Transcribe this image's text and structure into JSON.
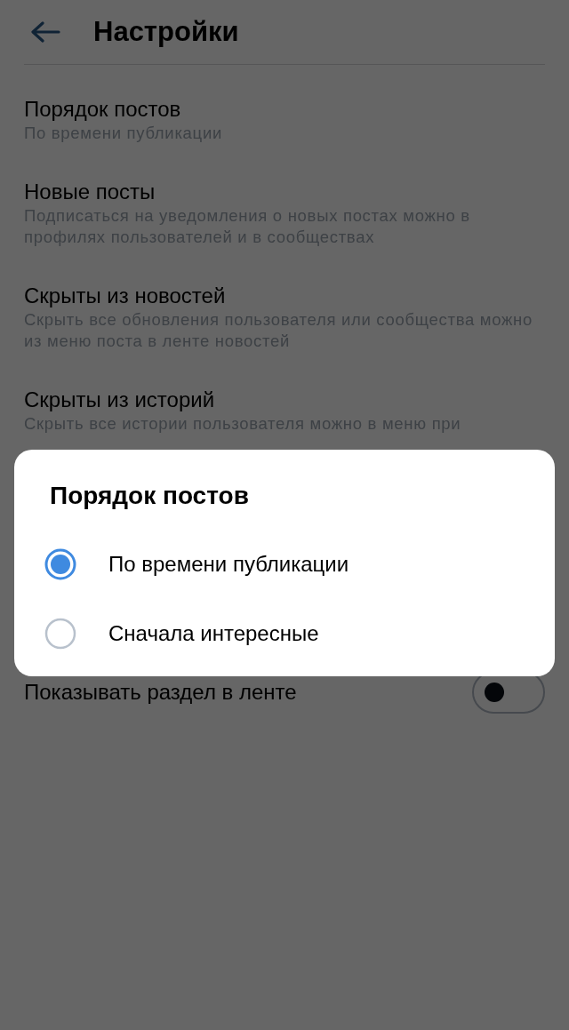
{
  "header": {
    "title": "Настройки"
  },
  "settings": [
    {
      "title": "Порядок постов",
      "subtitle": "По времени публикации"
    },
    {
      "title": "Новые посты",
      "subtitle": "Подписаться на уведомления о новых постах можно в профилях пользователей и в сообществах"
    },
    {
      "title": "Скрыты из новостей",
      "subtitle": "Скрыть все обновления пользователя или сообщества можно из меню поста в ленте новостей"
    },
    {
      "title": "Скрыты из историй",
      "subtitle": "Скрыть все истории пользователя можно в меню при"
    }
  ],
  "toggle_row": {
    "label": "Показывать раздел в ленте",
    "on": false
  },
  "dialog": {
    "title": "Порядок постов",
    "options": [
      {
        "label": "По времени публикации",
        "selected": true
      },
      {
        "label": "Сначала интересные",
        "selected": false
      }
    ]
  }
}
